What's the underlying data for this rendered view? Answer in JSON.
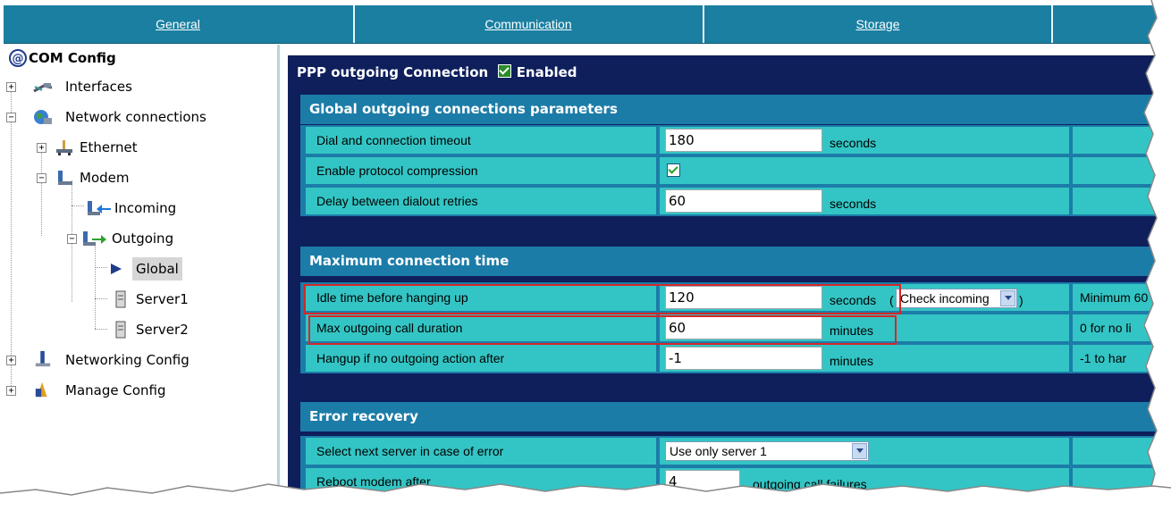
{
  "nav": {
    "tabs": [
      "General",
      "Communication",
      "Storage"
    ]
  },
  "tree": {
    "root": "COM Config",
    "items": [
      {
        "label": "Interfaces",
        "icon": "network-cable-icon"
      },
      {
        "label": "Network connections",
        "icon": "globe-network-icon"
      },
      {
        "label": "Ethernet",
        "icon": "ethernet-icon"
      },
      {
        "label": "Modem",
        "icon": "modem-icon"
      },
      {
        "label": "Incoming",
        "icon": "incoming-arrow-icon"
      },
      {
        "label": "Outgoing",
        "icon": "outgoing-arrow-icon"
      },
      {
        "label": "Global",
        "icon": "play-arrow-icon"
      },
      {
        "label": "Server1",
        "icon": "server-icon"
      },
      {
        "label": "Server2",
        "icon": "server-icon"
      },
      {
        "label": "Networking Config",
        "icon": "networking-config-icon"
      },
      {
        "label": "Manage Config",
        "icon": "manage-config-icon"
      }
    ]
  },
  "panel": {
    "title": "PPP outgoing Connection",
    "enabled_label": "Enabled",
    "sections": {
      "global": "Global outgoing connections parameters",
      "max_time": "Maximum connection time",
      "error": "Error recovery"
    },
    "rows": {
      "dial_timeout": {
        "label": "Dial and connection timeout",
        "value": "180",
        "unit": "seconds"
      },
      "compression": {
        "label": "Enable protocol compression",
        "checked": true
      },
      "retry_delay": {
        "label": "Delay between dialout retries",
        "value": "60",
        "unit": "seconds"
      },
      "idle_time": {
        "label": "Idle time before hanging up",
        "value": "120",
        "unit": "seconds",
        "paren_open": "(",
        "paren_close": ")",
        "select": "Check incoming",
        "extra": "Minimum 60"
      },
      "max_duration": {
        "label": "Max outgoing call duration",
        "value": "60",
        "unit": "minutes",
        "extra": "0 for no li"
      },
      "hangup_no_action": {
        "label": "Hangup if no outgoing action after",
        "value": "-1",
        "unit": "minutes",
        "extra": "-1 to har"
      },
      "next_server": {
        "label": "Select next server in case of error",
        "select": "Use only server 1"
      },
      "reboot": {
        "label": "Reboot modem after",
        "value": "4",
        "unit": "outgoing call failures"
      }
    }
  },
  "colors": {
    "nav": "#1a7fa1",
    "panel_bg": "#0e1f5c",
    "section": "#1c7ca8",
    "cell": "#33c5c5",
    "highlight": "#d42828"
  }
}
